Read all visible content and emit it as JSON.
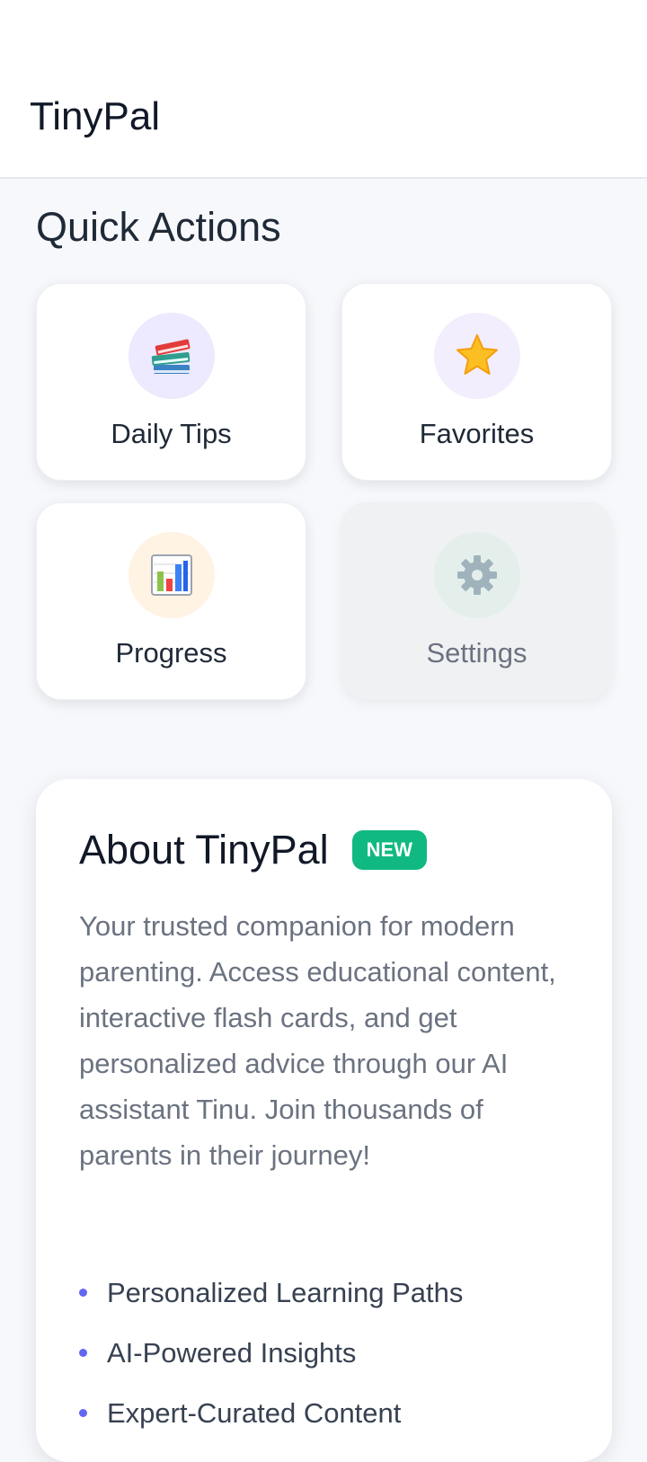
{
  "header": {
    "title": "TinyPal"
  },
  "quick_actions": {
    "title": "Quick Actions",
    "items": [
      {
        "label": "Daily Tips",
        "icon": "books-icon",
        "icon_bg": "#ede9fe"
      },
      {
        "label": "Favorites",
        "icon": "star-icon",
        "icon_bg": "#f3eefe"
      },
      {
        "label": "Progress",
        "icon": "bar-chart-icon",
        "icon_bg": "#fff3e3"
      },
      {
        "label": "Settings",
        "icon": "gear-icon",
        "icon_bg": "#e4efec",
        "disabled": true
      }
    ]
  },
  "about": {
    "title": "About TinyPal",
    "badge": "NEW",
    "description": "Your trusted companion for modern parenting. Access educational content, interactive flash cards, and get personalized advice through our AI assistant Tinu. Join thousands of parents in their journey!",
    "features": [
      "Personalized Learning Paths",
      "AI-Powered Insights",
      "Expert-Curated Content"
    ]
  },
  "colors": {
    "badge_green": "#10b981",
    "bullet_indigo": "#6366f1",
    "text_dark": "#111827",
    "text_muted": "#6b7280"
  }
}
